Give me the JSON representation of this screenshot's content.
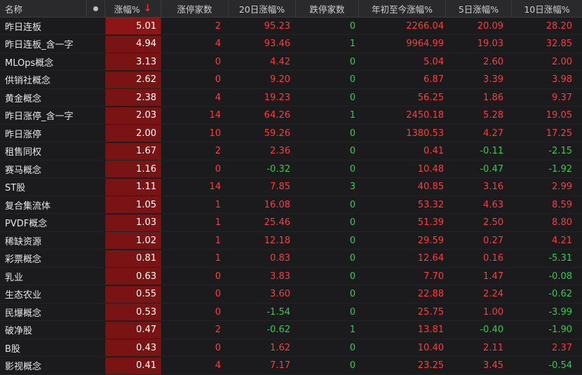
{
  "header": {
    "name": "名称",
    "pct": "涨幅%",
    "sort_arrow": "↓",
    "up_count": "涨停家数",
    "change_20d": "20日涨幅%",
    "down_count": "跌停家数",
    "ytd": "年初至今涨幅%",
    "change_5d": "5日涨幅%",
    "change_10d": "10日涨幅%"
  },
  "colors": {
    "up": "#ff3b3b",
    "down": "#2dcf4b",
    "pct_bg_top": "#8e1515",
    "pct_bg": "#7a1414"
  },
  "rows": [
    {
      "name": "昨日连板",
      "pct": "5.01",
      "up": "2",
      "d20": "95.23",
      "down": "0",
      "ytd": "2266.04",
      "d5": "20.09",
      "d10": "28.20"
    },
    {
      "name": "昨日连板_含一字",
      "pct": "4.94",
      "up": "4",
      "d20": "93.46",
      "down": "1",
      "ytd": "9964.99",
      "d5": "19.03",
      "d10": "32.85"
    },
    {
      "name": "MLOps概念",
      "pct": "3.13",
      "up": "0",
      "d20": "4.42",
      "down": "0",
      "ytd": "5.04",
      "d5": "2.60",
      "d10": "2.00"
    },
    {
      "name": "供销社概念",
      "pct": "2.62",
      "up": "0",
      "d20": "9.20",
      "down": "0",
      "ytd": "6.87",
      "d5": "3.39",
      "d10": "3.98"
    },
    {
      "name": "黄金概念",
      "pct": "2.38",
      "up": "4",
      "d20": "19.23",
      "down": "0",
      "ytd": "56.25",
      "d5": "1.86",
      "d10": "9.37"
    },
    {
      "name": "昨日涨停_含一字",
      "pct": "2.03",
      "up": "14",
      "d20": "64.26",
      "down": "1",
      "ytd": "2450.18",
      "d5": "5.28",
      "d10": "19.05"
    },
    {
      "name": "昨日涨停",
      "pct": "2.00",
      "up": "10",
      "d20": "59.26",
      "down": "0",
      "ytd": "1380.53",
      "d5": "4.27",
      "d10": "17.25"
    },
    {
      "name": "租售同权",
      "pct": "1.67",
      "up": "2",
      "d20": "2.36",
      "down": "0",
      "ytd": "0.41",
      "d5": "-0.11",
      "d10": "-2.15"
    },
    {
      "name": "赛马概念",
      "pct": "1.16",
      "up": "0",
      "d20": "-0.32",
      "down": "0",
      "ytd": "10.48",
      "d5": "-0.47",
      "d10": "-1.92"
    },
    {
      "name": "ST股",
      "pct": "1.11",
      "up": "14",
      "d20": "7.85",
      "down": "3",
      "ytd": "40.85",
      "d5": "3.16",
      "d10": "2.99"
    },
    {
      "name": "复合集流体",
      "pct": "1.05",
      "up": "1",
      "d20": "16.08",
      "down": "0",
      "ytd": "53.32",
      "d5": "4.63",
      "d10": "8.59"
    },
    {
      "name": "PVDF概念",
      "pct": "1.03",
      "up": "1",
      "d20": "25.46",
      "down": "0",
      "ytd": "51.39",
      "d5": "2.50",
      "d10": "8.80"
    },
    {
      "name": "稀缺资源",
      "pct": "1.02",
      "up": "1",
      "d20": "12.18",
      "down": "0",
      "ytd": "29.59",
      "d5": "0.27",
      "d10": "4.21"
    },
    {
      "name": "彩票概念",
      "pct": "0.81",
      "up": "1",
      "d20": "0.83",
      "down": "0",
      "ytd": "12.64",
      "d5": "0.16",
      "d10": "-5.31"
    },
    {
      "name": "乳业",
      "pct": "0.63",
      "up": "0",
      "d20": "3.83",
      "down": "0",
      "ytd": "7.70",
      "d5": "1.47",
      "d10": "-0.08"
    },
    {
      "name": "生态农业",
      "pct": "0.55",
      "up": "0",
      "d20": "3.60",
      "down": "0",
      "ytd": "22.88",
      "d5": "2.24",
      "d10": "-0.62"
    },
    {
      "name": "民爆概念",
      "pct": "0.53",
      "up": "0",
      "d20": "-1.54",
      "down": "0",
      "ytd": "25.75",
      "d5": "1.00",
      "d10": "-3.99"
    },
    {
      "name": "破净股",
      "pct": "0.47",
      "up": "2",
      "d20": "-0.62",
      "down": "1",
      "ytd": "13.81",
      "d5": "-0.40",
      "d10": "-1.90"
    },
    {
      "name": "B股",
      "pct": "0.43",
      "up": "0",
      "d20": "1.62",
      "down": "0",
      "ytd": "10.40",
      "d5": "2.11",
      "d10": "2.37"
    },
    {
      "name": "影视概念",
      "pct": "0.41",
      "up": "4",
      "d20": "7.17",
      "down": "0",
      "ytd": "23.25",
      "d5": "3.45",
      "d10": "-0.54"
    }
  ]
}
